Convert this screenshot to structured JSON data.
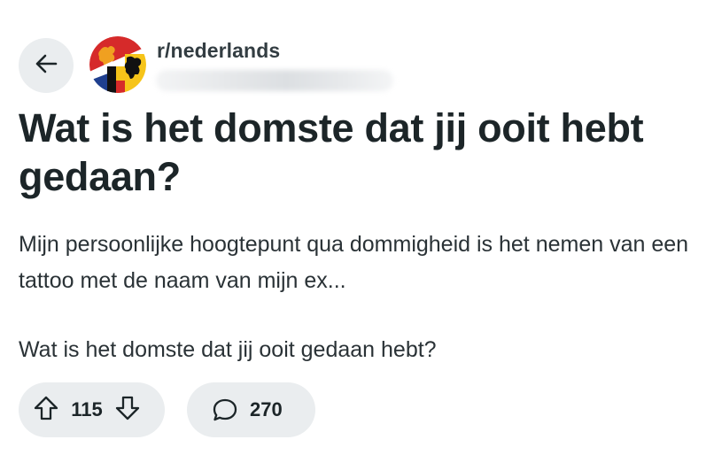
{
  "header": {
    "back_icon": "arrow-left-icon",
    "subreddit_icon": "subreddit-flag-avatar",
    "subreddit_name": "r/nederlands",
    "username_blurred": true,
    "colors": {
      "flag_red": "#d62a2a",
      "flag_blue": "#1f3f8f",
      "flag_yellow": "#f6c419",
      "flag_orange": "#ef7d1a",
      "flag_black": "#111111"
    }
  },
  "post": {
    "title": "Wat is het domste dat jij ooit hebt gedaan?",
    "body": [
      "Mijn persoonlijke hoogtepunt qua dommigheid is het nemen van een tattoo met de naam van mijn ex...",
      "Wat is het domste dat jij ooit gedaan hebt?"
    ]
  },
  "actions": {
    "upvote_icon": "arrow-up-outline-icon",
    "downvote_icon": "arrow-down-outline-icon",
    "vote_count": "115",
    "comment_icon": "speech-bubble-icon",
    "comment_count": "270"
  },
  "theme": {
    "pill_background": "#eaedef",
    "text_primary": "#1c2528"
  }
}
